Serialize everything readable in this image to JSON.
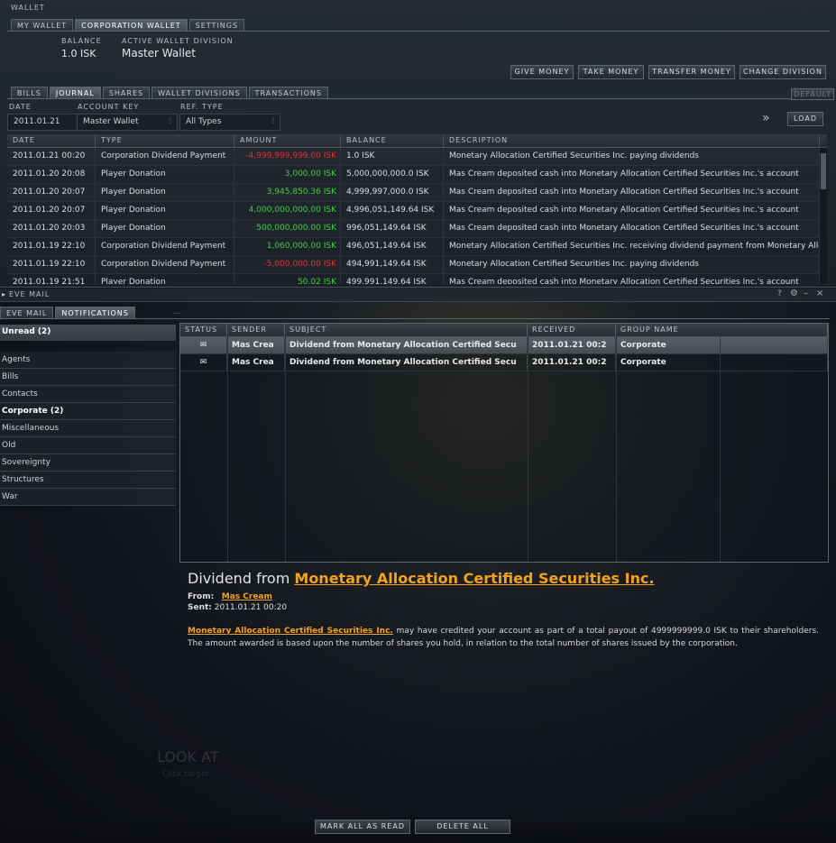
{
  "wallet": {
    "title": "WALLET",
    "tabs": [
      "MY WALLET",
      "CORPORATION WALLET",
      "SETTINGS"
    ],
    "balance_label": "BALANCE",
    "balance_value": "1.0 ISK",
    "division_label": "ACTIVE WALLET DIVISION",
    "division_value": "Master Wallet",
    "buttons": [
      "GIVE MONEY",
      "TAKE MONEY",
      "TRANSFER MONEY",
      "CHANGE DIVISION"
    ],
    "subtabs": [
      "BILLS",
      "JOURNAL",
      "SHARES",
      "WALLET DIVISIONS",
      "TRANSACTIONS"
    ],
    "default_label": "DEFAULT",
    "filters": {
      "date_label": "DATE",
      "date_value": "2011.01.21",
      "account_label": "ACCOUNT KEY",
      "account_value": "Master Wallet",
      "reftype_label": "REF. TYPE",
      "reftype_value": "All Types",
      "load_label": "LOAD"
    },
    "journal": {
      "columns": [
        "DATE",
        "TYPE",
        "AMOUNT",
        "BALANCE",
        "DESCRIPTION"
      ],
      "rows": [
        {
          "date": "2011.01.21 00:20",
          "type": "Corporation Dividend Payment",
          "amount": "-4,999,999,999.00",
          "sign": "neg",
          "balance": "1.0 ISK",
          "description": "Monetary Allocation Certified Securities Inc. paying dividends"
        },
        {
          "date": "2011.01.20 20:08",
          "type": "Player Donation",
          "amount": "3,000.00",
          "sign": "pos",
          "balance": "5,000,000,000.0 ISK",
          "description": "Mas Cream deposited cash into Monetary Allocation Certified Securities Inc.'s account"
        },
        {
          "date": "2011.01.20 20:07",
          "type": "Player Donation",
          "amount": "3,945,850.36",
          "sign": "pos",
          "balance": "4,999,997,000.0 ISK",
          "description": "Mas Cream deposited cash into Monetary Allocation Certified Securities Inc.'s account"
        },
        {
          "date": "2011.01.20 20:07",
          "type": "Player Donation",
          "amount": "4,000,000,000.00",
          "sign": "pos",
          "balance": "4,996,051,149.64 ISK",
          "description": "Mas Cream deposited cash into Monetary Allocation Certified Securities Inc.'s account"
        },
        {
          "date": "2011.01.20 20:03",
          "type": "Player Donation",
          "amount": "500,000,000.00",
          "sign": "pos",
          "balance": "996,051,149.64 ISK",
          "description": "Mas Cream deposited cash into Monetary Allocation Certified Securities Inc.'s account"
        },
        {
          "date": "2011.01.19 22:10",
          "type": "Corporation Dividend Payment",
          "amount": "1,060,000.00",
          "sign": "pos",
          "balance": "496,051,149.64 ISK",
          "description": "Monetary Allocation Certified Securities Inc. receiving dividend payment from Monetary Alloca"
        },
        {
          "date": "2011.01.19 22:10",
          "type": "Corporation Dividend Payment",
          "amount": "-5,000,000.00",
          "sign": "neg",
          "balance": "494,991,149.64 ISK",
          "description": "Monetary Allocation Certified Securities Inc. paying dividends"
        },
        {
          "date": "2011.01.19 21:51",
          "type": "Player Donation",
          "amount": "50.02",
          "sign": "pos",
          "balance": "499,991,149.64 ISK",
          "description": "Mas Cream deposited cash into Monetary Allocation Certified Securities Inc.'s account"
        }
      ],
      "currency": "ISK"
    }
  },
  "mail": {
    "title": "EVE MAIL",
    "tabs": [
      "EVE MAIL",
      "NOTIFICATIONS"
    ],
    "more": "...",
    "controls": [
      "?",
      "–",
      "×"
    ],
    "sidebar": {
      "header": "Unread (2)",
      "items": [
        "Agents",
        "Bills",
        "Contacts",
        "Corporate (2)",
        "Miscellaneous",
        "Old",
        "Sovereignty",
        "Structures",
        "War"
      ]
    },
    "notifications": {
      "columns": [
        "STATUS",
        "SENDER",
        "SUBJECT",
        "RECEIVED",
        "GROUP NAME"
      ],
      "rows": [
        {
          "sender": "Mas Crea",
          "subject": "Dividend from Monetary Allocation Certified Secu",
          "received": "2011.01.21 00:2",
          "group": "Corporate"
        },
        {
          "sender": "Mas Crea",
          "subject": "Dividend from Monetary Allocation Certified Secu",
          "received": "2011.01.21 00:2",
          "group": "Corporate"
        }
      ]
    },
    "reading": {
      "title_prefix": "Dividend from",
      "title_link": "Monetary Allocation Certified Securities Inc.",
      "from_label": "From:",
      "from_value": "Mas Cream",
      "sent_label": "Sent:",
      "sent_value": "2011.01.21 00:20",
      "body_link": "Monetary Allocation Certified Securities Inc.",
      "body_text": " may have credited your account as part of a total payout of 4999999999.0 ISK to their shareholders. The amount awarded is based upon the number of shares you hold, in relation to the total number of shares issued by the corporation."
    },
    "bottom_buttons": [
      "MARK ALL AS READ",
      "DELETE ALL"
    ],
    "background_text": [
      "LOOK AT",
      "Click target"
    ]
  },
  "colors": {
    "positive": "#3fcf3f",
    "negative": "#e03232",
    "link": "#f4a21a",
    "accent": "#5a636e"
  }
}
